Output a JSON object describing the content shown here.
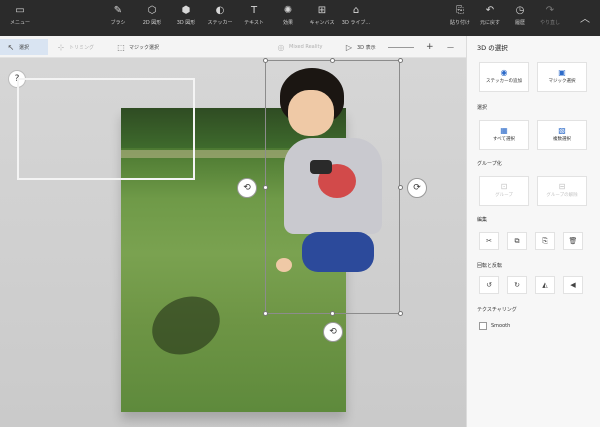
{
  "ribbon": {
    "menu_label": "メニュー",
    "tools": [
      {
        "label": "ブラシ",
        "icon": "brush-icon",
        "glyph": "✎"
      },
      {
        "label": "2D 図形",
        "icon": "shapes2d-icon",
        "glyph": "⬡"
      },
      {
        "label": "3D 図形",
        "icon": "shapes3d-icon",
        "glyph": "⬢"
      },
      {
        "label": "ステッカー",
        "icon": "sticker-icon",
        "glyph": "◐"
      },
      {
        "label": "テキスト",
        "icon": "text-icon",
        "glyph": "T"
      },
      {
        "label": "効果",
        "icon": "effects-icon",
        "glyph": "✺"
      },
      {
        "label": "キャンバス",
        "icon": "canvas-icon",
        "glyph": "⊞"
      },
      {
        "label": "3D ライブ...",
        "icon": "library3d-icon",
        "glyph": "⌂"
      }
    ],
    "right_tools": [
      {
        "label": "貼り付け",
        "icon": "paste-icon",
        "glyph": "⎘"
      },
      {
        "label": "元に戻す",
        "icon": "undo-icon",
        "glyph": "↶"
      },
      {
        "label": "履歴",
        "icon": "history-icon",
        "glyph": "◷"
      },
      {
        "label": "やり直し",
        "icon": "redo-icon",
        "glyph": "↷"
      }
    ]
  },
  "toolbar": {
    "select_label": "選択",
    "crop_label": "トリミング",
    "magic_select_label": "マジック選択",
    "mixed_reality_label": "Mixed Reality",
    "view3d_label": "3D 表示",
    "zoom_plus": "+",
    "zoom_minus": "—",
    "more": "···"
  },
  "canvas": {
    "help_glyph": "?",
    "rotate_left_glyph": "⟲",
    "rotate_right_glyph": "⟳",
    "rotate_bottom_glyph": "⟲"
  },
  "panel": {
    "title": "3D の選択",
    "top_buttons": [
      {
        "label": "ステッカーの追加",
        "icon": "add-sticker-icon",
        "glyph": "◉"
      },
      {
        "label": "マジック選択",
        "icon": "magic-select-icon",
        "glyph": "▣"
      }
    ],
    "section_select": "選択",
    "select_buttons": [
      {
        "label": "すべて選択",
        "icon": "select-all-icon",
        "glyph": "▦"
      },
      {
        "label": "複数選択",
        "icon": "multi-select-icon",
        "glyph": "▧"
      }
    ],
    "section_group": "グループ化",
    "group_buttons": [
      {
        "label": "グループ",
        "icon": "group-icon",
        "glyph": "⊡"
      },
      {
        "label": "グループの解除",
        "icon": "ungroup-icon",
        "glyph": "⊟"
      }
    ],
    "section_edit": "編集",
    "edit_buttons": [
      {
        "name": "cut",
        "icon": "cut-icon",
        "glyph": "✂"
      },
      {
        "name": "copy",
        "icon": "copy-icon",
        "glyph": "⧉"
      },
      {
        "name": "paste",
        "icon": "paste-icon",
        "glyph": "⎘"
      },
      {
        "name": "delete",
        "icon": "delete-icon",
        "glyph": "🗑"
      }
    ],
    "section_rotate": "回転と反転",
    "rotate_buttons": [
      {
        "name": "rotate-left",
        "icon": "rotate-left-icon",
        "glyph": "↺"
      },
      {
        "name": "rotate-right",
        "icon": "rotate-right-icon",
        "glyph": "↻"
      },
      {
        "name": "flip-vertical",
        "icon": "flip-vertical-icon",
        "glyph": "◭"
      },
      {
        "name": "flip-horizontal",
        "icon": "flip-horizontal-icon",
        "glyph": "◀"
      }
    ],
    "section_texturing": "テクスチャリング",
    "smooth_label": "Smooth"
  }
}
